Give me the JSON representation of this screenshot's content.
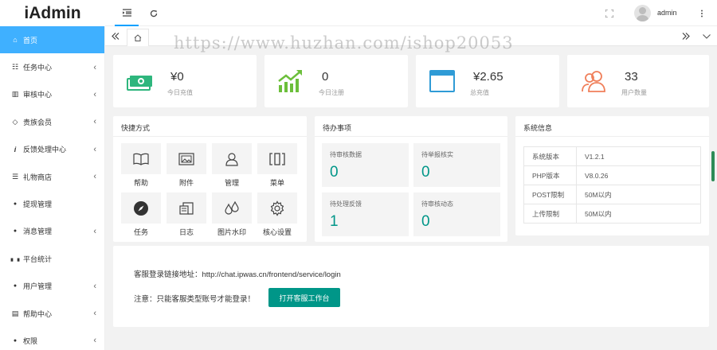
{
  "app": {
    "logo": "iAdmin"
  },
  "header": {
    "user_name": "admin"
  },
  "sidebar": {
    "items": [
      {
        "label": "首页",
        "icon": "home-icon",
        "glyph": "⌂",
        "arrow": ""
      },
      {
        "label": "任务中心",
        "icon": "list-icon",
        "glyph": "☷",
        "arrow": "‹"
      },
      {
        "label": "审核中心",
        "icon": "columns-icon",
        "glyph": "▥",
        "arrow": "‹"
      },
      {
        "label": "贵族会员",
        "icon": "diamond-icon",
        "glyph": "◇",
        "arrow": "‹"
      },
      {
        "label": "反馈处理中心",
        "icon": "info-icon",
        "glyph": "i",
        "arrow": "‹"
      },
      {
        "label": "礼物商店",
        "icon": "database-icon",
        "glyph": "☰",
        "arrow": "‹"
      },
      {
        "label": "提现管理",
        "icon": "money-bag-icon",
        "glyph": "●",
        "arrow": ""
      },
      {
        "label": "消息管理",
        "icon": "comment-icon",
        "glyph": "●",
        "arrow": "‹"
      },
      {
        "label": "平台统计",
        "icon": "bar-chart-icon",
        "glyph": "▖▗",
        "arrow": ""
      },
      {
        "label": "用户管理",
        "icon": "user-icon",
        "glyph": "●",
        "arrow": "‹"
      },
      {
        "label": "帮助中心",
        "icon": "file-icon",
        "glyph": "▤",
        "arrow": "‹"
      },
      {
        "label": "权限",
        "icon": "user-lock-icon",
        "glyph": "●",
        "arrow": "‹"
      }
    ]
  },
  "watermark": "https://www.huzhan.com/ishop20053",
  "stats": [
    {
      "value": "¥0",
      "label": "今日充值",
      "icon": "cash-icon",
      "color": "#2eb67d"
    },
    {
      "value": "0",
      "label": "今日注册",
      "icon": "growth-chart-icon",
      "color": "#6cbf3b"
    },
    {
      "value": "¥2.65",
      "label": "总充值",
      "icon": "browser-window-icon",
      "color": "#2f9bd6"
    },
    {
      "value": "33",
      "label": "用户数量",
      "icon": "users-icon",
      "color": "#f07f5a"
    }
  ],
  "shortcuts": {
    "title": "快捷方式",
    "items": [
      {
        "label": "帮助",
        "icon": "book-icon"
      },
      {
        "label": "附件",
        "icon": "image-icon"
      },
      {
        "label": "管理",
        "icon": "user-outline-icon"
      },
      {
        "label": "菜单",
        "icon": "columns-icon"
      },
      {
        "label": "任务",
        "icon": "compass-icon"
      },
      {
        "label": "日志",
        "icon": "log-icon"
      },
      {
        "label": "图片水印",
        "icon": "drops-icon"
      },
      {
        "label": "核心设置",
        "icon": "gear-icon"
      }
    ]
  },
  "todo": {
    "title": "待办事项",
    "items": [
      {
        "label": "待审核数据",
        "value": "0"
      },
      {
        "label": "待举报核实",
        "value": "0"
      },
      {
        "label": "待处理反馈",
        "value": "1"
      },
      {
        "label": "待审核动态",
        "value": "0"
      }
    ]
  },
  "sysinfo": {
    "title": "系统信息",
    "rows": [
      {
        "key": "系统版本",
        "value": "V1.2.1"
      },
      {
        "key": "PHP版本",
        "value": "V8.0.26"
      },
      {
        "key": "POST限制",
        "value": "50M以内"
      },
      {
        "key": "上传限制",
        "value": "50M以内"
      }
    ]
  },
  "service": {
    "link_text": "客服登录链接地址：http://chat.ipwas.cn/frontend/service/login",
    "note_text": "注意：只能客服类型账号才能登录！",
    "button_label": "打开客服工作台"
  }
}
